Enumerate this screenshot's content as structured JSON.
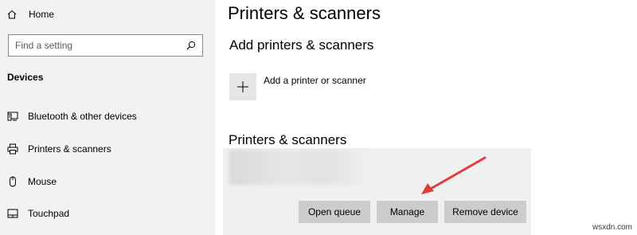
{
  "sidebar": {
    "home_label": "Home",
    "search_placeholder": "Find a setting",
    "section_label": "Devices",
    "items": [
      {
        "label": "Bluetooth & other devices",
        "icon": "bluetooth-devices-icon"
      },
      {
        "label": "Printers & scanners",
        "icon": "printer-icon"
      },
      {
        "label": "Mouse",
        "icon": "mouse-icon"
      },
      {
        "label": "Touchpad",
        "icon": "touchpad-icon"
      }
    ]
  },
  "main": {
    "title": "Printers & scanners",
    "add_section_heading": "Add printers & scanners",
    "add_label": "Add a printer or scanner",
    "list_heading": "Printers & scanners",
    "buttons": {
      "open_queue": "Open queue",
      "manage": "Manage",
      "remove_device": "Remove device"
    }
  },
  "annotation": {
    "arrow_color": "#e03c3c"
  },
  "watermark": "wsxdn.com",
  "colors": {
    "sidebar_bg": "#f2f2f2",
    "panel_bg": "#f0f0f0",
    "button_bg": "#cccccc"
  }
}
